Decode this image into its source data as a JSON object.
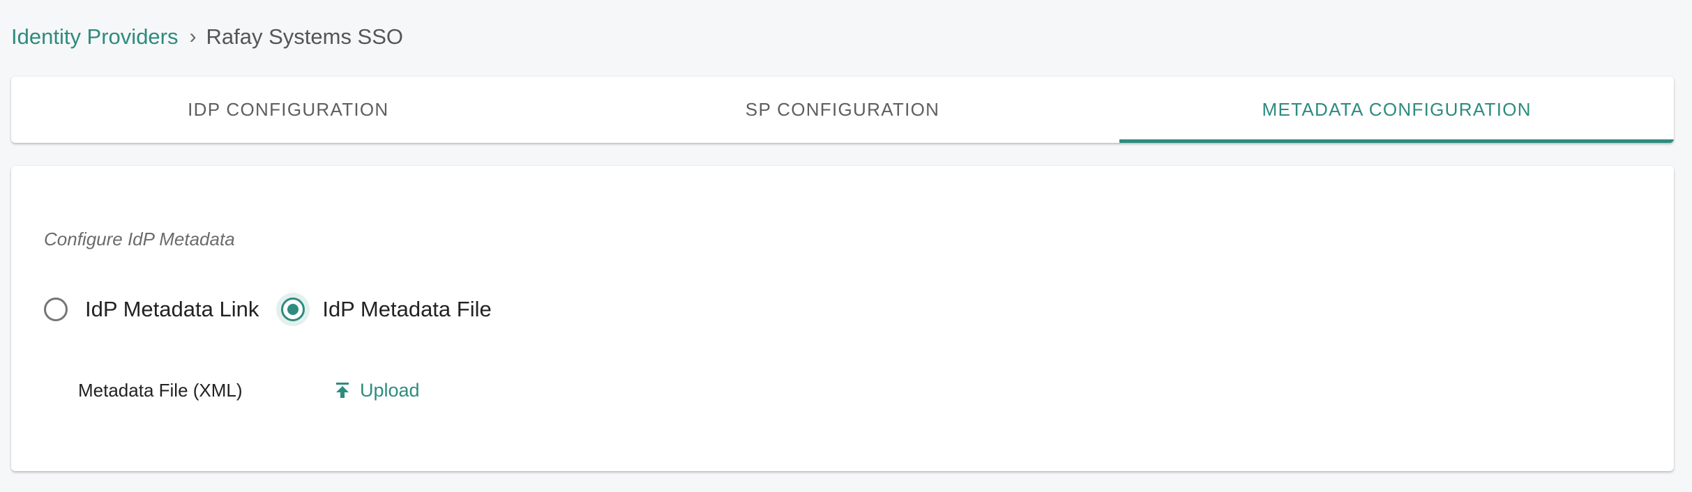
{
  "breadcrumb": {
    "parent": "Identity Providers",
    "separator": "›",
    "current": "Rafay Systems SSO"
  },
  "tabs": [
    {
      "label": "IDP CONFIGURATION",
      "active": false
    },
    {
      "label": "SP CONFIGURATION",
      "active": false
    },
    {
      "label": "METADATA CONFIGURATION",
      "active": true
    }
  ],
  "metadata": {
    "section_title": "Configure IdP Metadata",
    "options": [
      {
        "label": "IdP Metadata Link",
        "selected": false
      },
      {
        "label": "IdP Metadata File",
        "selected": true
      }
    ],
    "file_field_label": "Metadata File (XML)",
    "upload_label": "Upload",
    "upload_icon": "upload-icon"
  },
  "colors": {
    "accent": "#2d8b7f",
    "background": "#f6f7f8",
    "tab_inactive": "#5e5e5e"
  }
}
